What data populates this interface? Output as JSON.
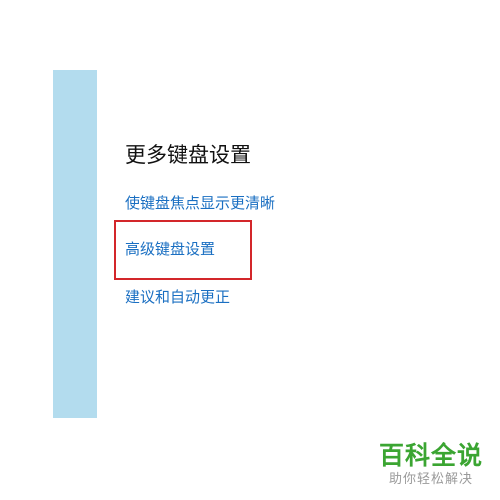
{
  "settings": {
    "section_title": "更多键盘设置",
    "links": [
      {
        "label": "使键盘焦点显示更清晰"
      },
      {
        "label": "高级键盘设置"
      },
      {
        "label": "建议和自动更正"
      }
    ]
  },
  "colors": {
    "side_panel": "#b3dcee",
    "link": "#1a6fc2",
    "highlight": "#d3262a",
    "watermark_green": "#3ba532",
    "watermark_gray": "#9a9a9a"
  },
  "watermark": {
    "title": "百科全说",
    "subtitle": "助你轻松解决"
  }
}
